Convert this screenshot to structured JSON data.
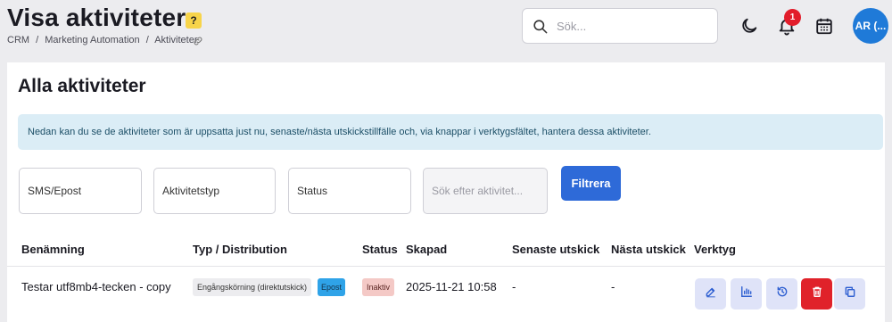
{
  "header": {
    "title": "Visa aktiviteter",
    "help_label": "?",
    "breadcrumb": [
      "CRM",
      "Marketing Automation",
      "Aktiviteter"
    ],
    "breadcrumb_separator": "/",
    "search_placeholder": "Sök...",
    "notification_count": "1",
    "avatar_initials": "AR (..."
  },
  "main": {
    "section_title": "Alla aktiviteter",
    "info_text": "Nedan kan du se de aktiviteter som är uppsatta just nu, senaste/nästa utskickstillfälle och, via knappar i verktygsfältet, hantera dessa aktiviteter.",
    "filters": {
      "channel": "SMS/Epost",
      "activity_type": "Aktivitetstyp",
      "status": "Status",
      "search_placeholder": "Sök efter aktivitet...",
      "button_label": "Filtrera"
    },
    "table": {
      "columns": [
        "Benämning",
        "Typ / Distribution",
        "Status",
        "Skapad",
        "Senaste utskick",
        "Nästa utskick",
        "Verktyg"
      ],
      "rows": [
        {
          "name": "Testar utf8mb4-tecken - copy",
          "type": "Engångskörning (direktutskick)",
          "distribution": "Epost",
          "status": "Inaktiv",
          "created": "2025-11-21 10:58",
          "last_send": "-",
          "next_send": "-"
        }
      ]
    },
    "tools": [
      "edit-icon",
      "stats-icon",
      "history-icon",
      "delete-icon",
      "copy-icon"
    ]
  },
  "colors": {
    "primary": "#2e6ad8",
    "info_bg": "#dbedf6",
    "danger": "#e0222a",
    "badge": "#e21d2b",
    "avatar": "#1f7ad8",
    "help": "#f7d44a",
    "tool_bg": "#dfe3f8",
    "distribution_tag": "#2fa3e8",
    "status_tag": "#f4c9c6"
  }
}
